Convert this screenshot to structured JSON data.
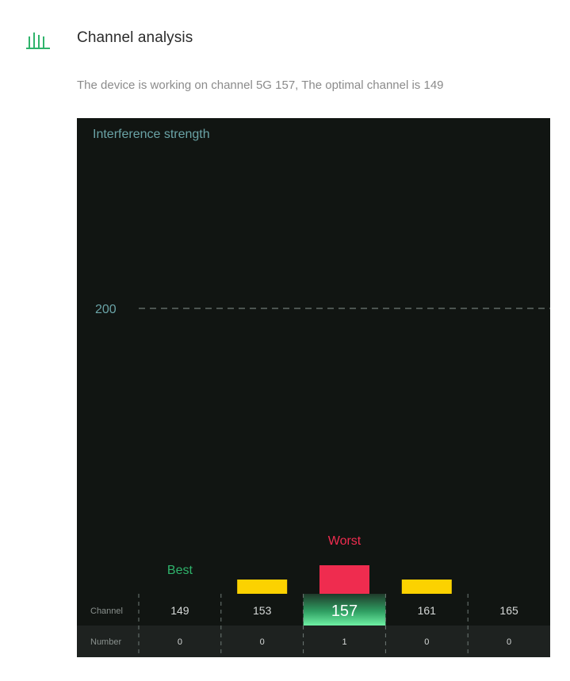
{
  "header": {
    "icon": "bar-chart-icon",
    "title": "Channel analysis"
  },
  "status": {
    "message": "The device is working on channel 5G 157, The optimal channel is 149"
  },
  "colors": {
    "accent_green": "#2fb36b",
    "worst_red": "#ef2c4f",
    "neutral_yellow": "#fcd200",
    "axis_teal": "#6aa3a6",
    "panel_bg": "#111512"
  },
  "chart_data": {
    "type": "bar",
    "ylabel": "Interference strength",
    "reference_line": {
      "value": 200,
      "label": "200",
      "style": "dashed"
    },
    "categories": [
      "149",
      "153",
      "157",
      "161",
      "165"
    ],
    "values": [
      0,
      10,
      20,
      10,
      0
    ],
    "ylim": [
      0,
      250
    ],
    "bar_colors": [
      "#2fb36b",
      "#fcd200",
      "#ef2c4f",
      "#fcd200",
      "#fcd200"
    ],
    "annotations": [
      {
        "category": "149",
        "text": "Best",
        "color": "#2fb36b"
      },
      {
        "category": "157",
        "text": "Worst",
        "color": "#ef2c4f"
      }
    ],
    "current_channel": "157",
    "row_labels": {
      "channel": "Channel",
      "number": "Number"
    },
    "numbers": [
      0,
      0,
      1,
      0,
      0
    ]
  }
}
